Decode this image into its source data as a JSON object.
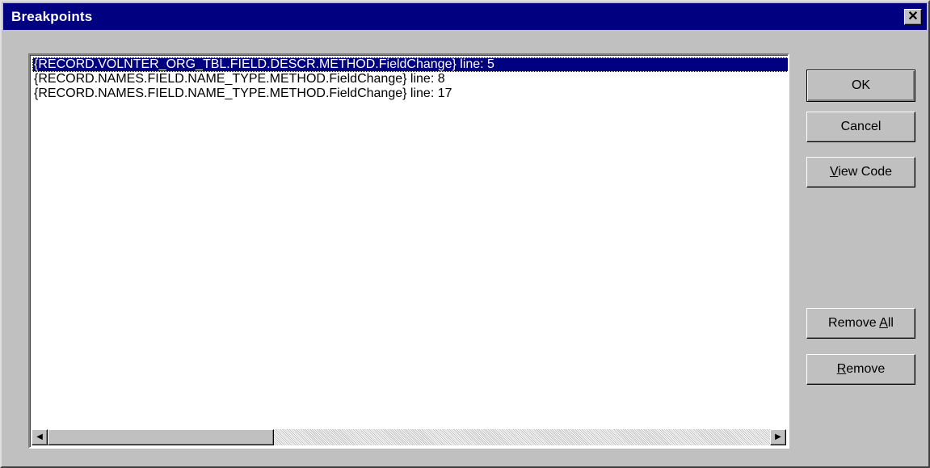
{
  "window": {
    "title": "Breakpoints",
    "close_glyph": "✕"
  },
  "breakpoints": [
    {
      "label": "{RECORD.VOLNTER_ORG_TBL.FIELD.DESCR.METHOD.FieldChange}  line: 5",
      "selected": true
    },
    {
      "label": "{RECORD.NAMES.FIELD.NAME_TYPE.METHOD.FieldChange}  line: 8",
      "selected": false
    },
    {
      "label": "{RECORD.NAMES.FIELD.NAME_TYPE.METHOD.FieldChange}  line: 17",
      "selected": false
    }
  ],
  "scrollbar": {
    "left_arrow": "◀",
    "right_arrow": "▶"
  },
  "buttons": {
    "ok": "OK",
    "cancel": "Cancel",
    "view_code_accel": "V",
    "view_code_rest": "iew Code",
    "remove_all_pre": "Remove ",
    "remove_all_accel": "A",
    "remove_all_rest": "ll",
    "remove_accel": "R",
    "remove_rest": "emove"
  },
  "colors": {
    "title_bar": "#000080",
    "selection": "#000080",
    "dialog_face": "#c0c0c0"
  }
}
